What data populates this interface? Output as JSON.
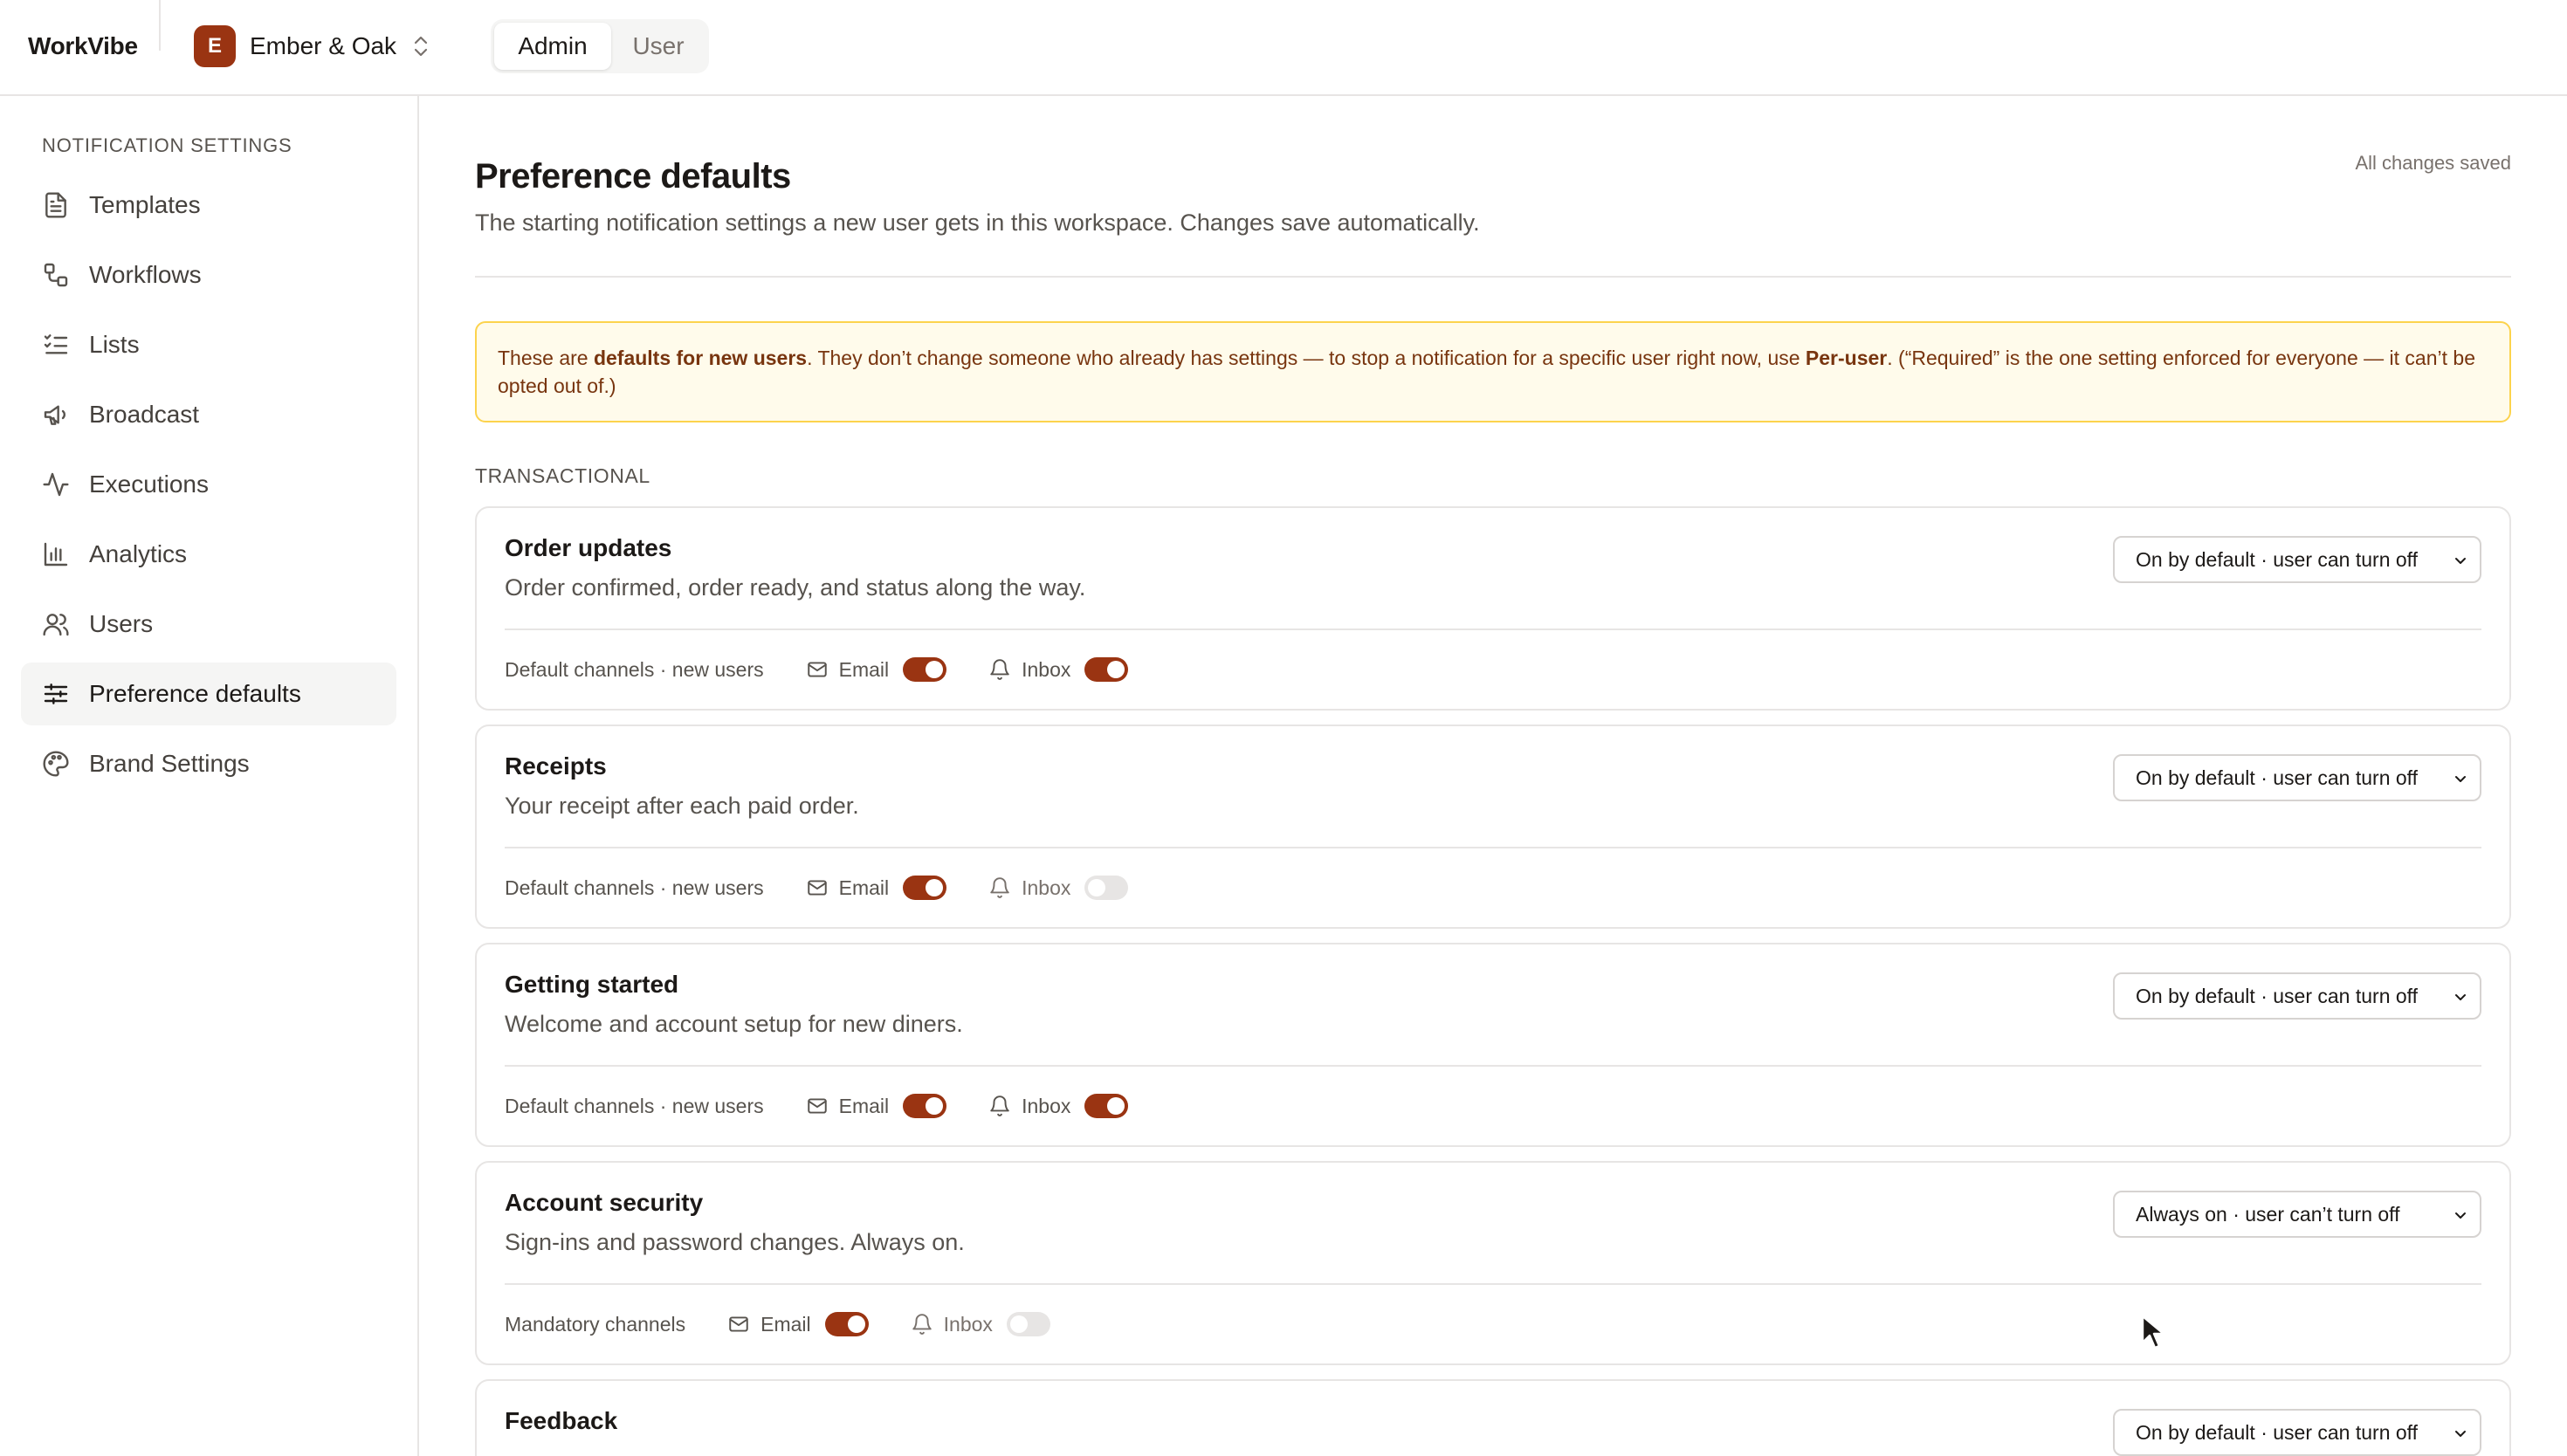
{
  "app": {
    "name": "WorkVibe"
  },
  "workspace": {
    "initial": "E",
    "name": "Ember & Oak"
  },
  "role_toggle": {
    "options": [
      "Admin",
      "User"
    ],
    "selected": "Admin"
  },
  "sidebar": {
    "heading": "NOTIFICATION SETTINGS",
    "items": [
      {
        "label": "Templates",
        "icon": "file-text-icon"
      },
      {
        "label": "Workflows",
        "icon": "workflow-icon"
      },
      {
        "label": "Lists",
        "icon": "list-checks-icon"
      },
      {
        "label": "Broadcast",
        "icon": "megaphone-icon"
      },
      {
        "label": "Executions",
        "icon": "activity-icon"
      },
      {
        "label": "Analytics",
        "icon": "bar-chart-icon"
      },
      {
        "label": "Users",
        "icon": "users-icon"
      },
      {
        "label": "Preference defaults",
        "icon": "sliders-icon",
        "active": true
      },
      {
        "label": "Brand Settings",
        "icon": "palette-icon"
      }
    ]
  },
  "page": {
    "title": "Preference defaults",
    "subtitle": "The starting notification settings a new user gets in this workspace. Changes save automatically.",
    "save_status": "All changes saved"
  },
  "notice": {
    "p1": "These are ",
    "b1": "defaults for new users",
    "p2": ". They don’t change someone who already has settings — to stop a notification for a specific user right now, use ",
    "b2": "Per-user",
    "p3": ". (“Required” is the one setting enforced for everyone — it can’t be opted out of.)"
  },
  "section": {
    "label": "TRANSACTIONAL"
  },
  "cards": [
    {
      "title": "Order updates",
      "description": "Order confirmed, order ready, and status along the way.",
      "policy": "On by default · user can turn off",
      "channels_label": "Default channels · new users",
      "email_label": "Email",
      "email_on": true,
      "inbox_label": "Inbox",
      "inbox_on": true
    },
    {
      "title": "Receipts",
      "description": "Your receipt after each paid order.",
      "policy": "On by default · user can turn off",
      "channels_label": "Default channels · new users",
      "email_label": "Email",
      "email_on": true,
      "inbox_label": "Inbox",
      "inbox_on": false
    },
    {
      "title": "Getting started",
      "description": "Welcome and account setup for new diners.",
      "policy": "On by default · user can turn off",
      "channels_label": "Default channels · new users",
      "email_label": "Email",
      "email_on": true,
      "inbox_label": "Inbox",
      "inbox_on": true
    },
    {
      "title": "Account security",
      "description": "Sign-ins and password changes. Always on.",
      "policy": "Always on · user can’t turn off",
      "channels_label": "Mandatory channels",
      "email_label": "Email",
      "email_on": true,
      "inbox_label": "Inbox",
      "inbox_on": false
    },
    {
      "title": "Feedback",
      "policy": "On by default · user can turn off"
    }
  ],
  "colors": {
    "accent": "#9a3412",
    "notice_bg": "#fffbeb",
    "notice_border": "#fcd34d"
  }
}
